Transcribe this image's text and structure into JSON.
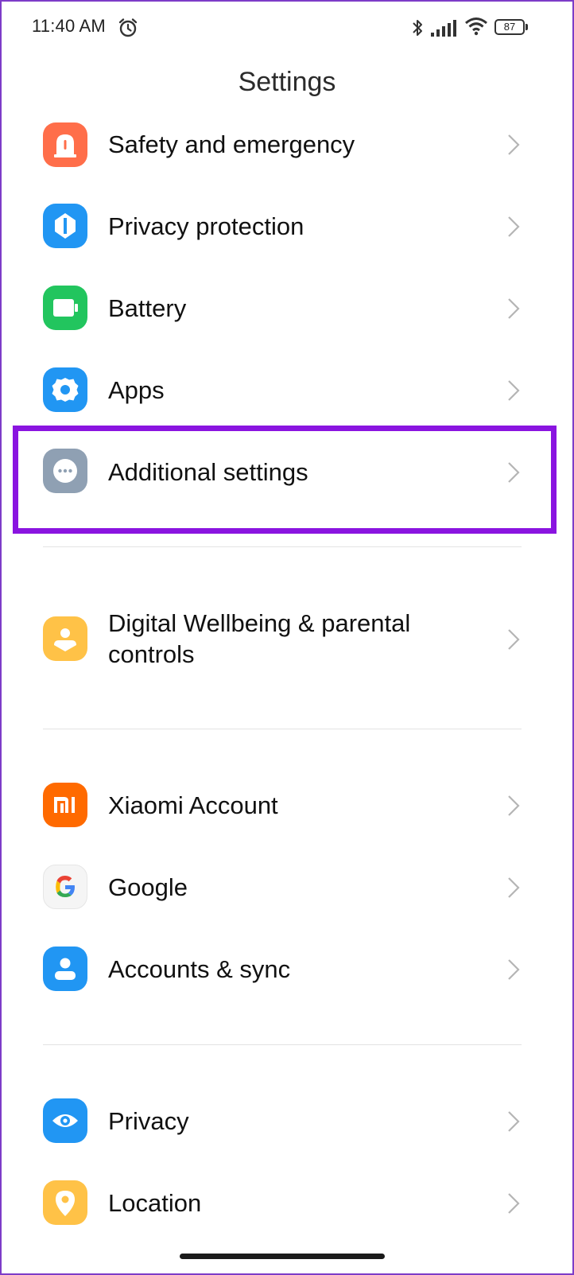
{
  "status_bar": {
    "time": "11:40 AM",
    "battery_level": "87",
    "icons": [
      "alarm-icon",
      "bluetooth-icon",
      "signal-icon",
      "wifi-icon",
      "battery-icon"
    ]
  },
  "header": {
    "title": "Settings"
  },
  "items": [
    {
      "label": "Safety and emergency",
      "icon": "safety-icon",
      "color": "#FF6E4A"
    },
    {
      "label": "Privacy protection",
      "icon": "privacy-protection-icon",
      "color": "#2196F3"
    },
    {
      "label": "Battery",
      "icon": "battery-icon",
      "color": "#22C55E"
    },
    {
      "label": "Apps",
      "icon": "gear-icon",
      "color": "#2196F3"
    },
    {
      "label": "Additional settings",
      "icon": "more-dots-icon",
      "color": "#8FA0B3",
      "highlighted": true
    },
    {
      "label": "Digital Wellbeing & parental controls",
      "icon": "wellbeing-icon",
      "color": "#FFC247"
    },
    {
      "label": "Xiaomi Account",
      "icon": "mi-icon",
      "color": "#FF6A00"
    },
    {
      "label": "Google",
      "icon": "google-icon",
      "color": "#F5F5F5"
    },
    {
      "label": "Accounts & sync",
      "icon": "account-icon",
      "color": "#2196F3"
    },
    {
      "label": "Privacy",
      "icon": "eye-icon",
      "color": "#2196F3"
    },
    {
      "label": "Location",
      "icon": "location-pin-icon",
      "color": "#FFC247"
    }
  ],
  "highlight_color": "#8A14E0"
}
